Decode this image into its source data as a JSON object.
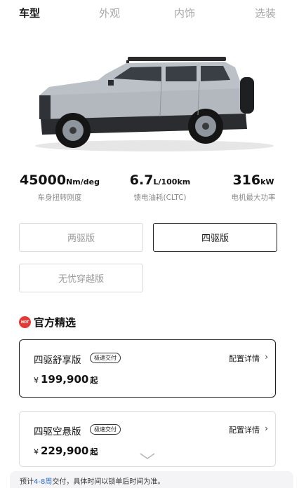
{
  "tabs": [
    {
      "label": "车型",
      "active": true
    },
    {
      "label": "外观",
      "active": false
    },
    {
      "label": "内饰",
      "active": false
    },
    {
      "label": "选装",
      "active": false
    }
  ],
  "specs": [
    {
      "value": "45000",
      "unit": "Nm/deg",
      "label": "车身扭转刚度"
    },
    {
      "value": "6.7",
      "unit": "L/100km",
      "label": "馈电油耗(CLTC)"
    },
    {
      "value": "316",
      "unit": "kW",
      "label": "电机最大功率"
    }
  ],
  "drive_options": [
    {
      "label": "两驱版",
      "selected": false
    },
    {
      "label": "四驱版",
      "selected": true
    },
    {
      "label": "无忧穿越版",
      "selected": false
    }
  ],
  "section": {
    "title": "官方精选",
    "badge_icon": "hot-icon",
    "badge_text": "HOT"
  },
  "cards": [
    {
      "name": "四驱舒享版",
      "badge": "极速交付",
      "detail": "配置详情",
      "currency": "¥",
      "price": "199,900",
      "suffix": "起",
      "selected": true
    },
    {
      "name": "四驱空悬版",
      "badge": "极速交付",
      "detail": "配置详情",
      "currency": "¥",
      "price": "229,900",
      "suffix": "起",
      "selected": false
    }
  ],
  "footer": {
    "prefix": "预计",
    "weeks": "4-8周",
    "rest": "交付，具体时间以锁单后时间为准。"
  },
  "colors": {
    "accent_red": "#e53935",
    "link_blue": "#2f6fd6",
    "car_body": "#b9bec4"
  }
}
